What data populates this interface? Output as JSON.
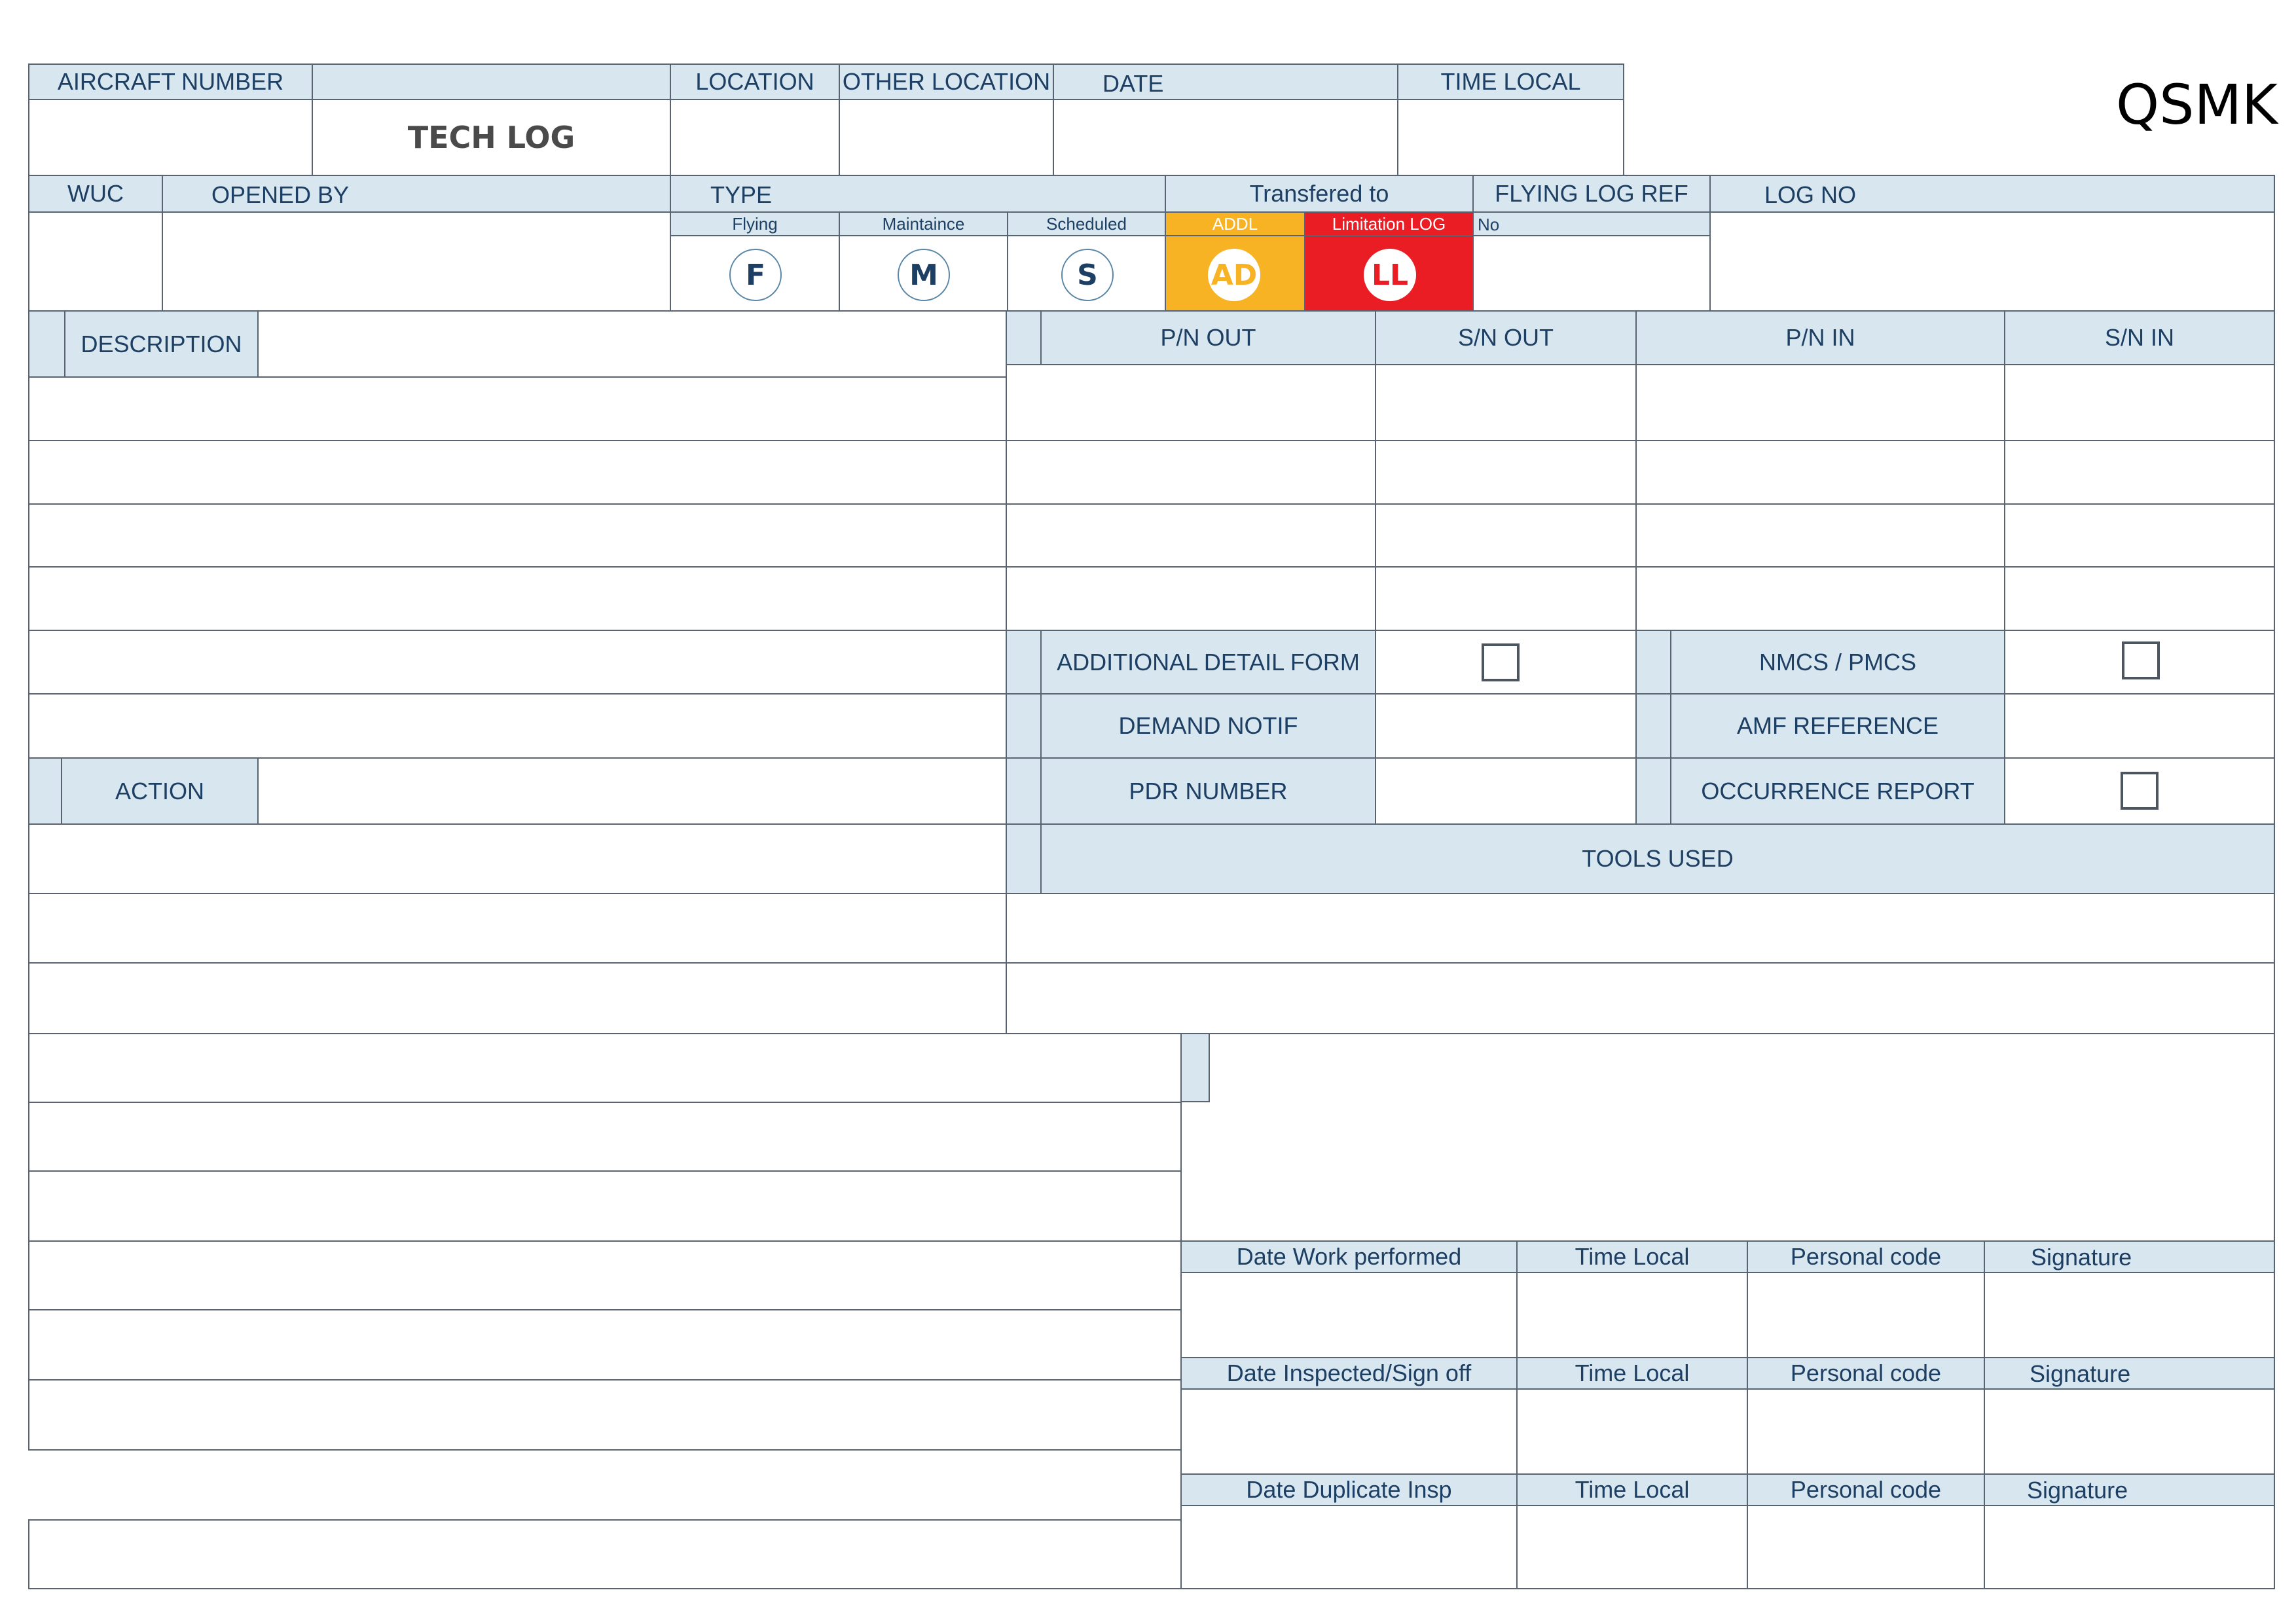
{
  "brand": "QSMK",
  "header": {
    "aircraft_number": "AIRCRAFT NUMBER",
    "form_title": "TECH LOG",
    "location": "LOCATION",
    "other_location": "OTHER LOCATION",
    "date": "DATE",
    "time_local": "TIME LOCAL"
  },
  "row2": {
    "wuc": "WUC",
    "opened_by": "OPENED BY",
    "type": "TYPE",
    "transferred_to": "Transfered to",
    "flying_log_ref": "FLYING LOG REF",
    "log_no": "LOG NO",
    "no": "No",
    "types": [
      {
        "label": "Flying",
        "symbol": "F"
      },
      {
        "label": "Maintaince",
        "symbol": "M"
      },
      {
        "label": "Scheduled",
        "symbol": "S"
      }
    ],
    "transfers": [
      {
        "label": "ADDL",
        "symbol": "AD",
        "color": "#f8b324"
      },
      {
        "label": "Limitation LOG",
        "symbol": "LL",
        "color": "#ea1c24"
      }
    ]
  },
  "description": "DESCRIPTION",
  "parts": {
    "pn_out": "P/N OUT",
    "sn_out": "S/N OUT",
    "pn_in": "P/N IN",
    "sn_in": "S/N IN"
  },
  "details": {
    "additional_detail_form": "ADDITIONAL DETAIL FORM",
    "demand_notif": "DEMAND NOTIF",
    "pdr_number": "PDR NUMBER",
    "nmcs_pmcs": "NMCS / PMCS",
    "amf_reference": "AMF REFERENCE",
    "occurrence_report": "OCCURRENCE REPORT",
    "tools_used": "TOOLS USED"
  },
  "action": "ACTION",
  "signoff": [
    {
      "date": "Date Work performed",
      "time": "Time Local",
      "code": "Personal code",
      "signature": "Signature"
    },
    {
      "date": "Date Inspected/Sign off",
      "time": "Time Local",
      "code": "Personal code",
      "signature": "Signature"
    },
    {
      "date": "Date Duplicate Insp",
      "time": "Time Local",
      "code": "Personal code",
      "signature": "Signature"
    }
  ],
  "colors": {
    "header_fill": "#d8e6ef",
    "text": "#1d3f63",
    "addl": "#f8b324",
    "limitation": "#ea1c24"
  }
}
